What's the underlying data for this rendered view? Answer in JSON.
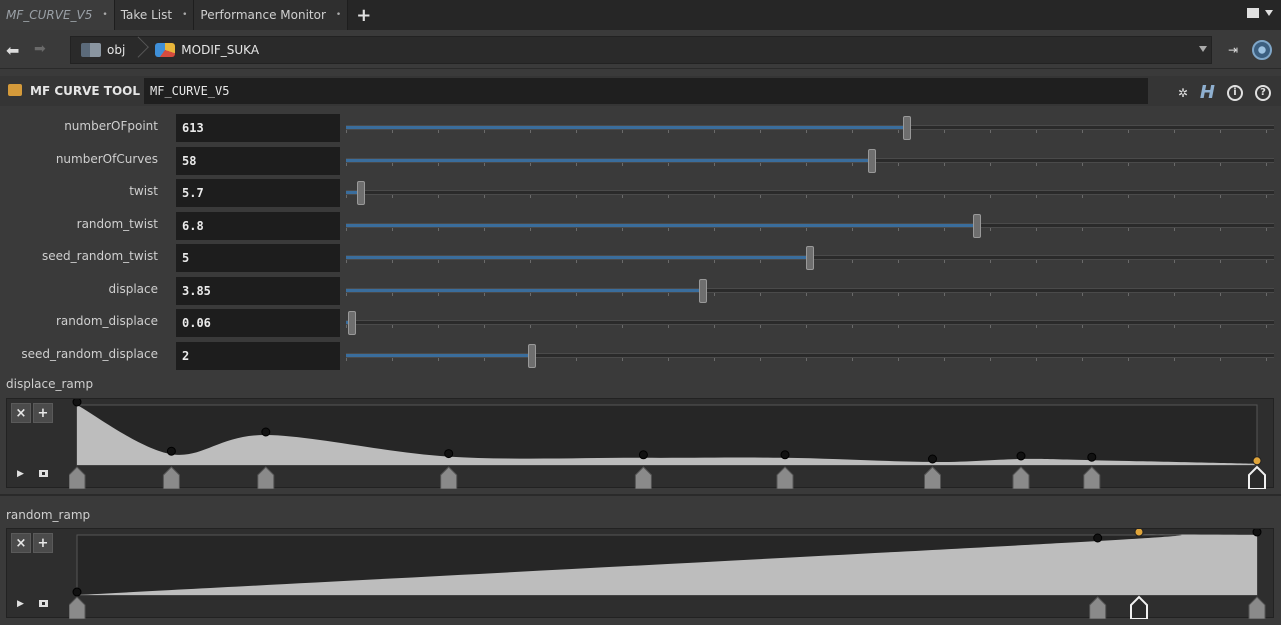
{
  "tabs": [
    {
      "label": "MF_CURVE_V5",
      "active": true
    },
    {
      "label": "Take List",
      "active": false
    },
    {
      "label": "Performance Monitor",
      "active": false
    }
  ],
  "tab_add_label": "+",
  "tab_close_glyph": "•",
  "path": {
    "crumbs": [
      {
        "label": "obj",
        "icon": "obj-network-icon"
      },
      {
        "label": "MODIF_SUKA",
        "icon": "subnet-node-icon"
      }
    ]
  },
  "node": {
    "type_label": "MF CURVE TOOL",
    "name": "MF_CURVE_V5",
    "help_glyph": "?",
    "info_glyph": "i",
    "gear_glyph": "✲",
    "houdini_glyph": "H"
  },
  "parameters": [
    {
      "label": "numberOFpoint",
      "value": "613",
      "slider_fraction": 0.604
    },
    {
      "label": "numberOfCurves",
      "value": "58",
      "slider_fraction": 0.567
    },
    {
      "label": "twist",
      "value": "5.7",
      "slider_fraction": 0.016
    },
    {
      "label": "random_twist",
      "value": "6.8",
      "slider_fraction": 0.68
    },
    {
      "label": "seed_random_twist",
      "value": "5",
      "slider_fraction": 0.5
    },
    {
      "label": "displace",
      "value": "3.85",
      "slider_fraction": 0.385
    },
    {
      "label": "random_displace",
      "value": "0.06",
      "slider_fraction": 0.006
    },
    {
      "label": "seed_random_displace",
      "value": "2",
      "slider_fraction": 0.2
    }
  ],
  "ramps": [
    {
      "label": "displace_ramp",
      "keys": [
        {
          "pos": 0.0,
          "value": 1.0
        },
        {
          "pos": 0.08,
          "value": 0.18
        },
        {
          "pos": 0.16,
          "value": 0.5
        },
        {
          "pos": 0.315,
          "value": 0.14
        },
        {
          "pos": 0.48,
          "value": 0.12
        },
        {
          "pos": 0.6,
          "value": 0.12
        },
        {
          "pos": 0.725,
          "value": 0.05
        },
        {
          "pos": 0.8,
          "value": 0.1
        },
        {
          "pos": 0.86,
          "value": 0.08
        },
        {
          "pos": 1.0,
          "value": 0.02
        }
      ],
      "selected_key": 9
    },
    {
      "label": "random_ramp",
      "keys": [
        {
          "pos": 0.0,
          "value": 0.0
        },
        {
          "pos": 0.865,
          "value": 0.9
        },
        {
          "pos": 0.9,
          "value": 1.0
        },
        {
          "pos": 1.0,
          "value": 1.0
        }
      ],
      "selected_key": 2
    }
  ],
  "ramp_buttons": {
    "delete": "×",
    "add": "+"
  },
  "colors": {
    "slider_fill": "#3a6d9c",
    "selected_key": "#e0a53a",
    "ramp_fill": "#bdbdbd",
    "node_icon": "#d49a3a"
  }
}
